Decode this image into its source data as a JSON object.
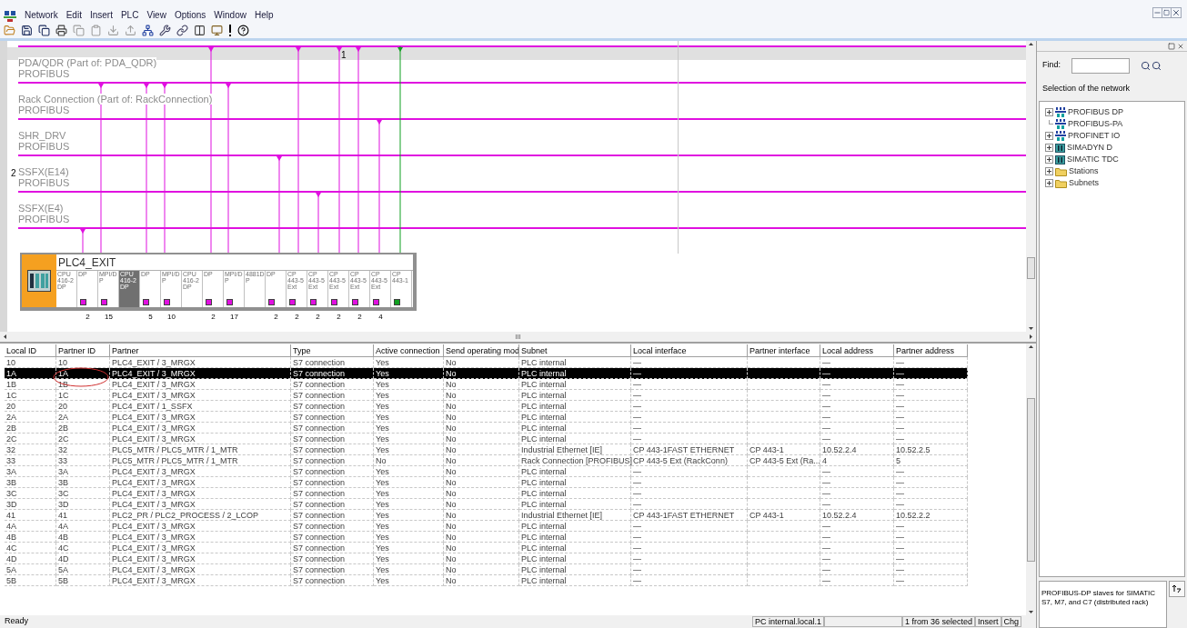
{
  "menu": [
    "Network",
    "Edit",
    "Insert",
    "PLC",
    "View",
    "Options",
    "Window",
    "Help"
  ],
  "diagram": {
    "marker": "1",
    "subnets": [
      {
        "name": "PDA/QDR (Part of: PDA_QDR)",
        "type": "PROFIBUS"
      },
      {
        "name": "Rack Connection (Part of: RackConnection)",
        "type": "PROFIBUS"
      },
      {
        "name": "SHR_DRV",
        "type": "PROFIBUS"
      },
      {
        "name": "SSFX(E14)",
        "type": "PROFIBUS",
        "index": "2"
      },
      {
        "name": "SSFX(E4)",
        "type": "PROFIBUS"
      }
    ],
    "scroll_mark": "III",
    "station": {
      "name": "PLC4_EXIT",
      "modules": [
        {
          "label": "CPU 416-2 DP",
          "selected": false
        },
        {
          "label": "DP",
          "selected": false,
          "color": "#e010e0",
          "count": "2"
        },
        {
          "label": "MPI/DP",
          "selected": false,
          "color": "#e010e0",
          "count": "15"
        },
        {
          "label": "CPU 416-2 DP",
          "selected": true
        },
        {
          "label": "DP",
          "selected": false,
          "color": "#e010e0",
          "count": "5"
        },
        {
          "label": "MPI/DP",
          "selected": false,
          "color": "#e010e0",
          "count": "10"
        },
        {
          "label": "CPU 416-2 DP",
          "selected": false
        },
        {
          "label": "DP",
          "selected": false,
          "color": "#e010e0",
          "count": "2"
        },
        {
          "label": "MPI/DP",
          "selected": false,
          "color": "#e010e0",
          "count": "17"
        },
        {
          "label": "4881DP",
          "selected": false
        },
        {
          "label": "DP",
          "selected": false,
          "color": "#e010e0",
          "count": "2"
        },
        {
          "label": "CP 443-5 Ext",
          "selected": false,
          "color": "#e010e0",
          "count": "2"
        },
        {
          "label": "CP 443-5 Ext",
          "selected": false,
          "color": "#e010e0",
          "count": "2"
        },
        {
          "label": "CP 443-5 Ext",
          "selected": false,
          "color": "#e010e0",
          "count": "2"
        },
        {
          "label": "CP 443-5 Ext",
          "selected": false,
          "color": "#e010e0",
          "count": "2"
        },
        {
          "label": "CP 443-5 Ext",
          "selected": false,
          "color": "#e010e0",
          "count": "4"
        },
        {
          "label": "CP 443-1",
          "selected": false,
          "color": "#10a020"
        }
      ]
    }
  },
  "table": {
    "columns": [
      "Local ID",
      "Partner ID",
      "Partner",
      "Type",
      "Active connection",
      "Send operating mod",
      "Subnet",
      "Local interface",
      "Partner interface",
      "Local address",
      "Partner address"
    ],
    "rows": [
      {
        "selected": false,
        "cells": [
          "10",
          "10",
          "PLC4_EXIT / 3_MRGX",
          "S7 connection",
          "Yes",
          "No",
          "PLC internal",
          "—",
          "",
          "—",
          "—"
        ]
      },
      {
        "selected": true,
        "cells": [
          "1A",
          "1A",
          "PLC4_EXIT / 3_MRGX",
          "S7 connection",
          "Yes",
          "No",
          "PLC internal",
          "—",
          "",
          "—",
          "—"
        ]
      },
      {
        "selected": false,
        "cells": [
          "1B",
          "1B",
          "PLC4_EXIT / 3_MRGX",
          "S7 connection",
          "Yes",
          "No",
          "PLC internal",
          "—",
          "",
          "—",
          "—"
        ]
      },
      {
        "selected": false,
        "cells": [
          "1C",
          "1C",
          "PLC4_EXIT / 3_MRGX",
          "S7 connection",
          "Yes",
          "No",
          "PLC internal",
          "—",
          "",
          "—",
          "—"
        ]
      },
      {
        "selected": false,
        "cells": [
          "20",
          "20",
          "PLC4_EXIT / 1_SSFX",
          "S7 connection",
          "Yes",
          "No",
          "PLC internal",
          "—",
          "",
          "—",
          "—"
        ]
      },
      {
        "selected": false,
        "cells": [
          "2A",
          "2A",
          "PLC4_EXIT / 3_MRGX",
          "S7 connection",
          "Yes",
          "No",
          "PLC internal",
          "—",
          "",
          "—",
          "—"
        ]
      },
      {
        "selected": false,
        "cells": [
          "2B",
          "2B",
          "PLC4_EXIT / 3_MRGX",
          "S7 connection",
          "Yes",
          "No",
          "PLC internal",
          "—",
          "",
          "—",
          "—"
        ]
      },
      {
        "selected": false,
        "cells": [
          "2C",
          "2C",
          "PLC4_EXIT / 3_MRGX",
          "S7 connection",
          "Yes",
          "No",
          "PLC internal",
          "—",
          "",
          "—",
          "—"
        ]
      },
      {
        "selected": false,
        "cells": [
          "32",
          "32",
          "PLC5_MTR / PLC5_MTR / 1_MTR",
          "S7 connection",
          "Yes",
          "No",
          "Industrial Ethernet [IE]",
          "CP 443-1FAST ETHERNET",
          "CP 443-1",
          "10.52.2.4",
          "10.52.2.5"
        ]
      },
      {
        "selected": false,
        "cells": [
          "33",
          "33",
          "PLC5_MTR / PLC5_MTR / 1_MTR",
          "S7 connection",
          "No",
          "No",
          "Rack Connection [PROFIBUS]",
          "CP 443-5 Ext (RackConn)",
          "CP 443-5 Ext (Ra...",
          "4",
          "5"
        ]
      },
      {
        "selected": false,
        "cells": [
          "3A",
          "3A",
          "PLC4_EXIT / 3_MRGX",
          "S7 connection",
          "Yes",
          "No",
          "PLC internal",
          "—",
          "",
          "—",
          "—"
        ]
      },
      {
        "selected": false,
        "cells": [
          "3B",
          "3B",
          "PLC4_EXIT / 3_MRGX",
          "S7 connection",
          "Yes",
          "No",
          "PLC internal",
          "—",
          "",
          "—",
          "—"
        ]
      },
      {
        "selected": false,
        "cells": [
          "3C",
          "3C",
          "PLC4_EXIT / 3_MRGX",
          "S7 connection",
          "Yes",
          "No",
          "PLC internal",
          "—",
          "",
          "—",
          "—"
        ]
      },
      {
        "selected": false,
        "cells": [
          "3D",
          "3D",
          "PLC4_EXIT / 3_MRGX",
          "S7 connection",
          "Yes",
          "No",
          "PLC internal",
          "—",
          "",
          "—",
          "—"
        ]
      },
      {
        "selected": false,
        "cells": [
          "41",
          "41",
          "PLC2_PR / PLC2_PROCESS / 2_LCOP",
          "S7 connection",
          "Yes",
          "No",
          "Industrial Ethernet [IE]",
          "CP 443-1FAST ETHERNET",
          "CP 443-1",
          "10.52.2.4",
          "10.52.2.2"
        ]
      },
      {
        "selected": false,
        "cells": [
          "4A",
          "4A",
          "PLC4_EXIT / 3_MRGX",
          "S7 connection",
          "Yes",
          "No",
          "PLC internal",
          "—",
          "",
          "—",
          "—"
        ]
      },
      {
        "selected": false,
        "cells": [
          "4B",
          "4B",
          "PLC4_EXIT / 3_MRGX",
          "S7 connection",
          "Yes",
          "No",
          "PLC internal",
          "—",
          "",
          "—",
          "—"
        ]
      },
      {
        "selected": false,
        "cells": [
          "4C",
          "4C",
          "PLC4_EXIT / 3_MRGX",
          "S7 connection",
          "Yes",
          "No",
          "PLC internal",
          "—",
          "",
          "—",
          "—"
        ]
      },
      {
        "selected": false,
        "cells": [
          "4D",
          "4D",
          "PLC4_EXIT / 3_MRGX",
          "S7 connection",
          "Yes",
          "No",
          "PLC internal",
          "—",
          "",
          "—",
          "—"
        ]
      },
      {
        "selected": false,
        "cells": [
          "5A",
          "5A",
          "PLC4_EXIT / 3_MRGX",
          "S7 connection",
          "Yes",
          "No",
          "PLC internal",
          "—",
          "",
          "—",
          "—"
        ]
      },
      {
        "selected": false,
        "cells": [
          "5B",
          "5B",
          "PLC4_EXIT / 3_MRGX",
          "S7 connection",
          "Yes",
          "No",
          "PLC internal",
          "—",
          "",
          "—",
          "—"
        ]
      }
    ]
  },
  "panel": {
    "find_label": "Find:",
    "heading": "Selection of the network",
    "tree": [
      {
        "label": "PROFIBUS DP",
        "kind": "bus",
        "expandable": true
      },
      {
        "label": "PROFIBUS-PA",
        "kind": "bus",
        "expandable": false
      },
      {
        "label": "PROFINET IO",
        "kind": "bus",
        "expandable": true
      },
      {
        "label": "SIMADYN D",
        "kind": "rack",
        "expandable": true
      },
      {
        "label": "SIMATIC TDC",
        "kind": "rack",
        "expandable": true
      },
      {
        "label": "Stations",
        "kind": "folder",
        "expandable": true
      },
      {
        "label": "Subnets",
        "kind": "folder",
        "expandable": true
      }
    ],
    "description": "PROFIBUS-DP slaves for SIMATIC S7, M7, and C7 (distributed rack)"
  },
  "status_bar": {
    "message": "Ready",
    "fields": [
      "PC internal.local.1",
      "1 from 36 selected",
      "Insert",
      "Chg"
    ]
  }
}
